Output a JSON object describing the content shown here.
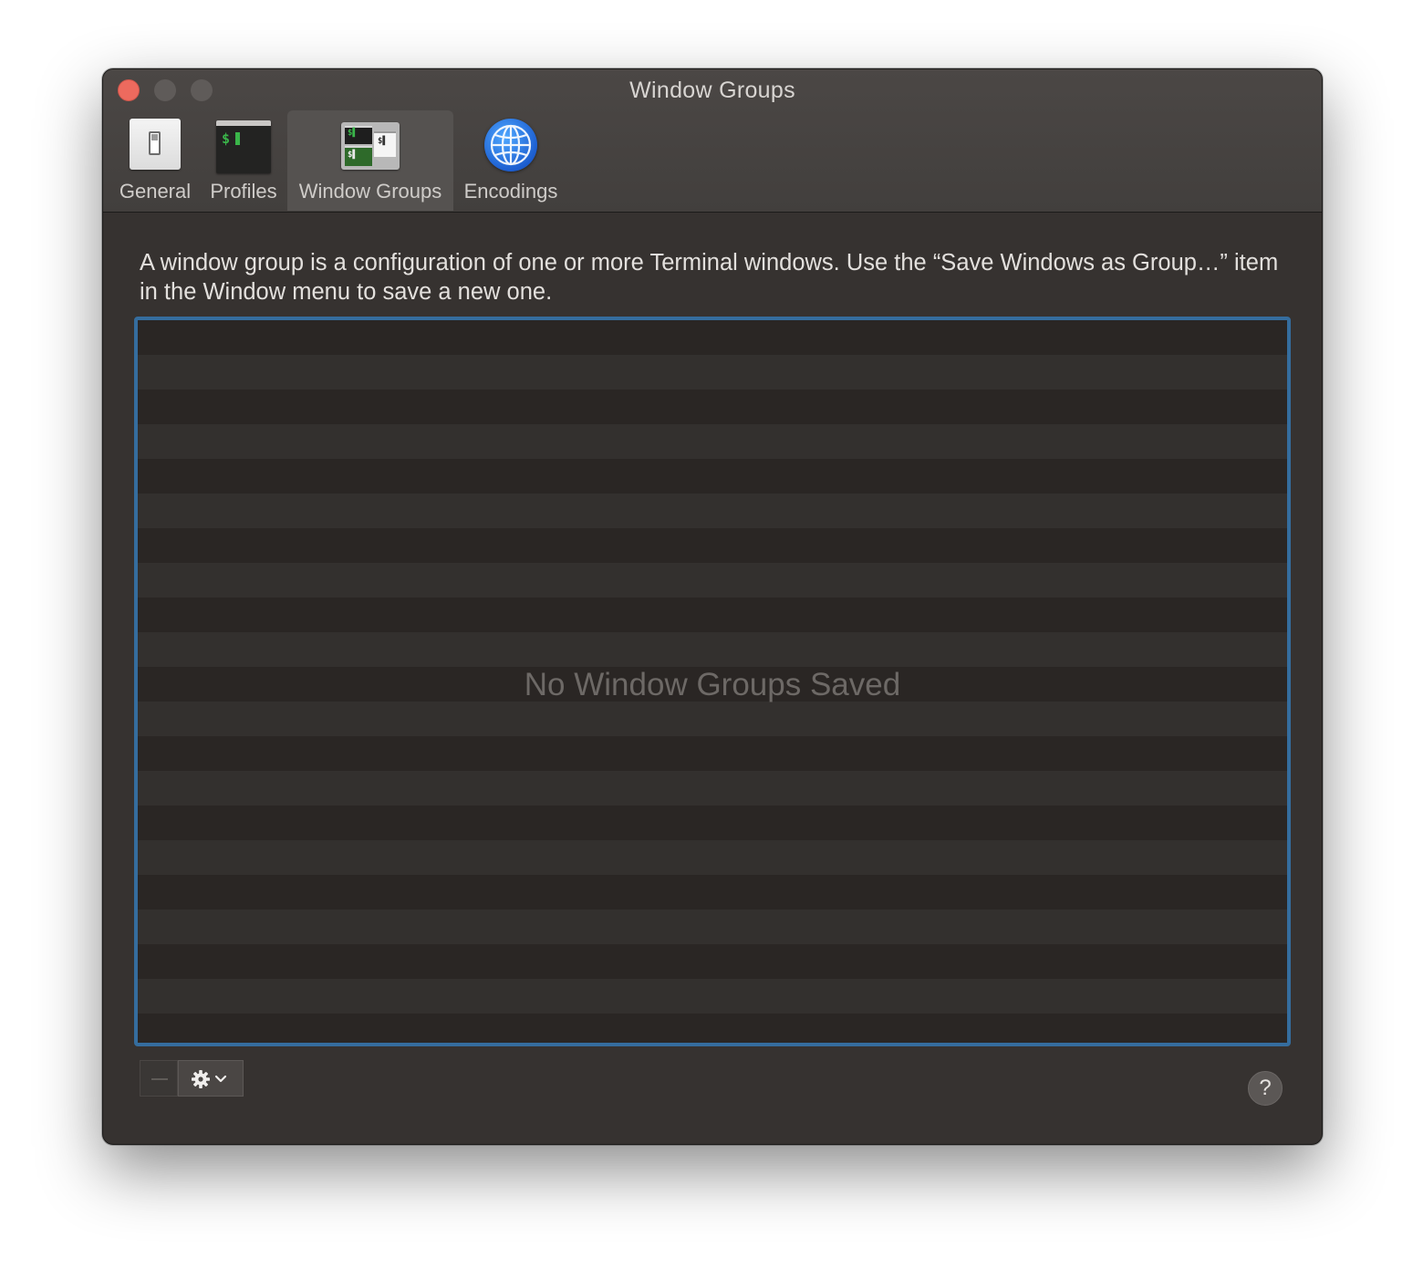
{
  "window": {
    "title": "Window Groups"
  },
  "toolbar": {
    "tabs": [
      {
        "label": "General",
        "icon": "switch-icon",
        "selected": false
      },
      {
        "label": "Profiles",
        "icon": "terminal-icon",
        "selected": false
      },
      {
        "label": "Window Groups",
        "icon": "window-groups-icon",
        "selected": true
      },
      {
        "label": "Encodings",
        "icon": "globe-icon",
        "selected": false
      }
    ]
  },
  "main": {
    "description": "A window group is a configuration of one or more Terminal windows. Use the “Save Windows as Group…” item in the Window menu to save a new one.",
    "empty_message": "No Window Groups Saved"
  },
  "footer": {
    "help_label": "?",
    "remove_icon": "minus-icon",
    "actions_icon": "gear-icon"
  },
  "colors": {
    "close": "#ed6a5e",
    "table_border": "#356d9e",
    "window_bg": "#363230"
  }
}
